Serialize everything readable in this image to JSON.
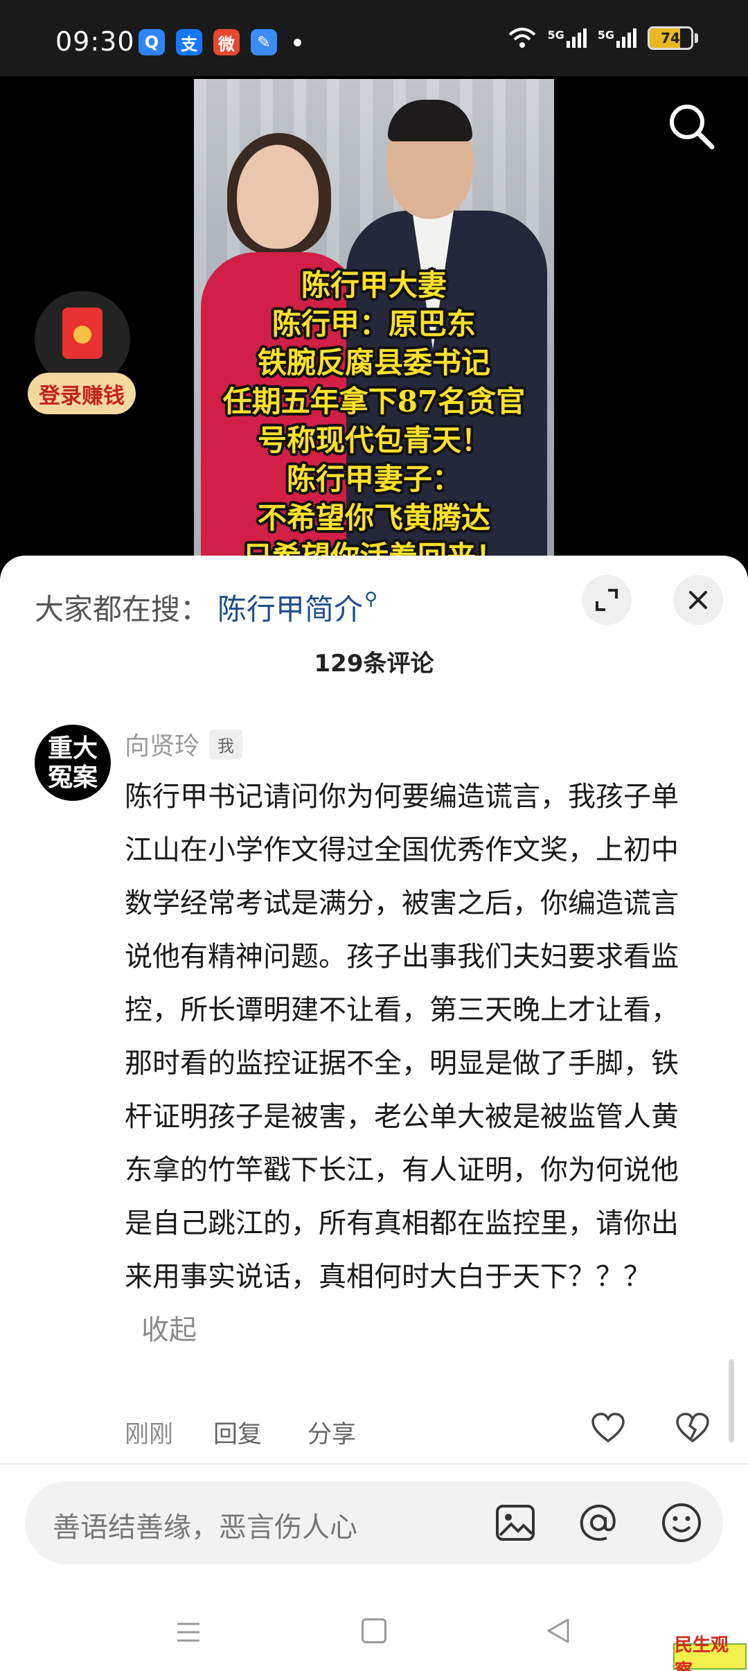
{
  "status_bar": {
    "time": "09:30",
    "apps": [
      {
        "icon": "qq-browser-icon",
        "glyph": "Q",
        "color": "#2f84f5"
      },
      {
        "icon": "alipay-icon",
        "glyph": "支",
        "color": "#1677ff"
      },
      {
        "icon": "weibo-icon",
        "glyph": "微",
        "color": "#e6472d"
      },
      {
        "icon": "notes-app-icon",
        "glyph": "✎",
        "color": "#3b8cf5"
      }
    ],
    "signal_1": "5G",
    "signal_2": "5G",
    "battery": "74",
    "battery_level": 0.74
  },
  "video": {
    "caption_lines": [
      "陈行甲大妻",
      "陈行甲：原巴东",
      "铁腕反腐县委书记",
      "任期五年拿下87名贪官",
      "号称现代包青天！",
      "陈行甲妻子：",
      "不希望你飞黄腾达",
      "只希望你活着回来！"
    ],
    "reward_label": "登录赚钱"
  },
  "comments_sheet": {
    "hot_search_prefix": "大家都在搜：",
    "hot_search_term": "陈行甲简介",
    "count_label": "129条评论",
    "comment": {
      "avatar_line1": "重大",
      "avatar_line2": "冤案",
      "username": "向贤玲",
      "badge": "我",
      "text": "陈行甲书记请问你为何要编造谎言，我孩子单江山在小学作文得过全国优秀作文奖，上初中数学经常考试是满分，被害之后，你编造谎言说他有精神问题。孩子出事我们夫妇要求看监控，所长谭明建不让看，第三天晚上才让看，那时看的监控证据不全，明显是做了手脚，铁杆证明孩子是被害，老公单大被是被监管人黄东拿的竹竿戳下长江，有人证明，你为何说他是自己跳江的，所有真相都在监控里，请你出来用事实说话，真相何时大白于天下？？？",
      "collapse_label": "收起",
      "time": "刚刚",
      "reply_label": "回复",
      "share_label": "分享"
    },
    "input_placeholder": "善语结善缘，恶言伤人心"
  },
  "watermark": "民生观察",
  "colors": {
    "link_blue": "#1f4e8a",
    "caption_yellow": "#ffe12a",
    "dress_red": "#d21f45"
  }
}
